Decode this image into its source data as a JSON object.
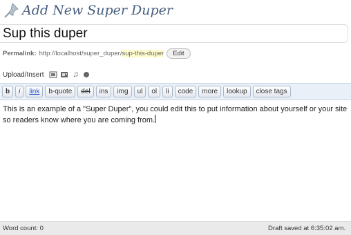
{
  "header": {
    "title": "Add New Super Duper",
    "icon": "pushpin-icon"
  },
  "post": {
    "title_value": "Sup this duper"
  },
  "permalink": {
    "label": "Permalink:",
    "base": "http://localhost/super_duper/",
    "slug": "sup-this-duper",
    "edit_label": "Edit"
  },
  "upload": {
    "label": "Upload/Insert",
    "icons": [
      "add-image-icon",
      "add-video-icon",
      "add-audio-icon",
      "add-media-icon"
    ]
  },
  "toolbar": {
    "buttons": [
      "b",
      "i",
      "link",
      "b-quote",
      "del",
      "ins",
      "img",
      "ul",
      "ol",
      "li",
      "code",
      "more",
      "lookup",
      "close tags"
    ]
  },
  "editor": {
    "content": "This is an example of a \"Super Duper\", you could edit this to put information about yourself or your site so readers know where you are coming from."
  },
  "status": {
    "word_count": "Word count: 0",
    "draft_saved": "Draft saved at 6:35:02 am."
  },
  "colors": {
    "title": "#465d7d",
    "toolbar_bg": "#e9f0f7",
    "slug_highlight": "#fffbcc",
    "status_bar": "#eaeaea"
  }
}
